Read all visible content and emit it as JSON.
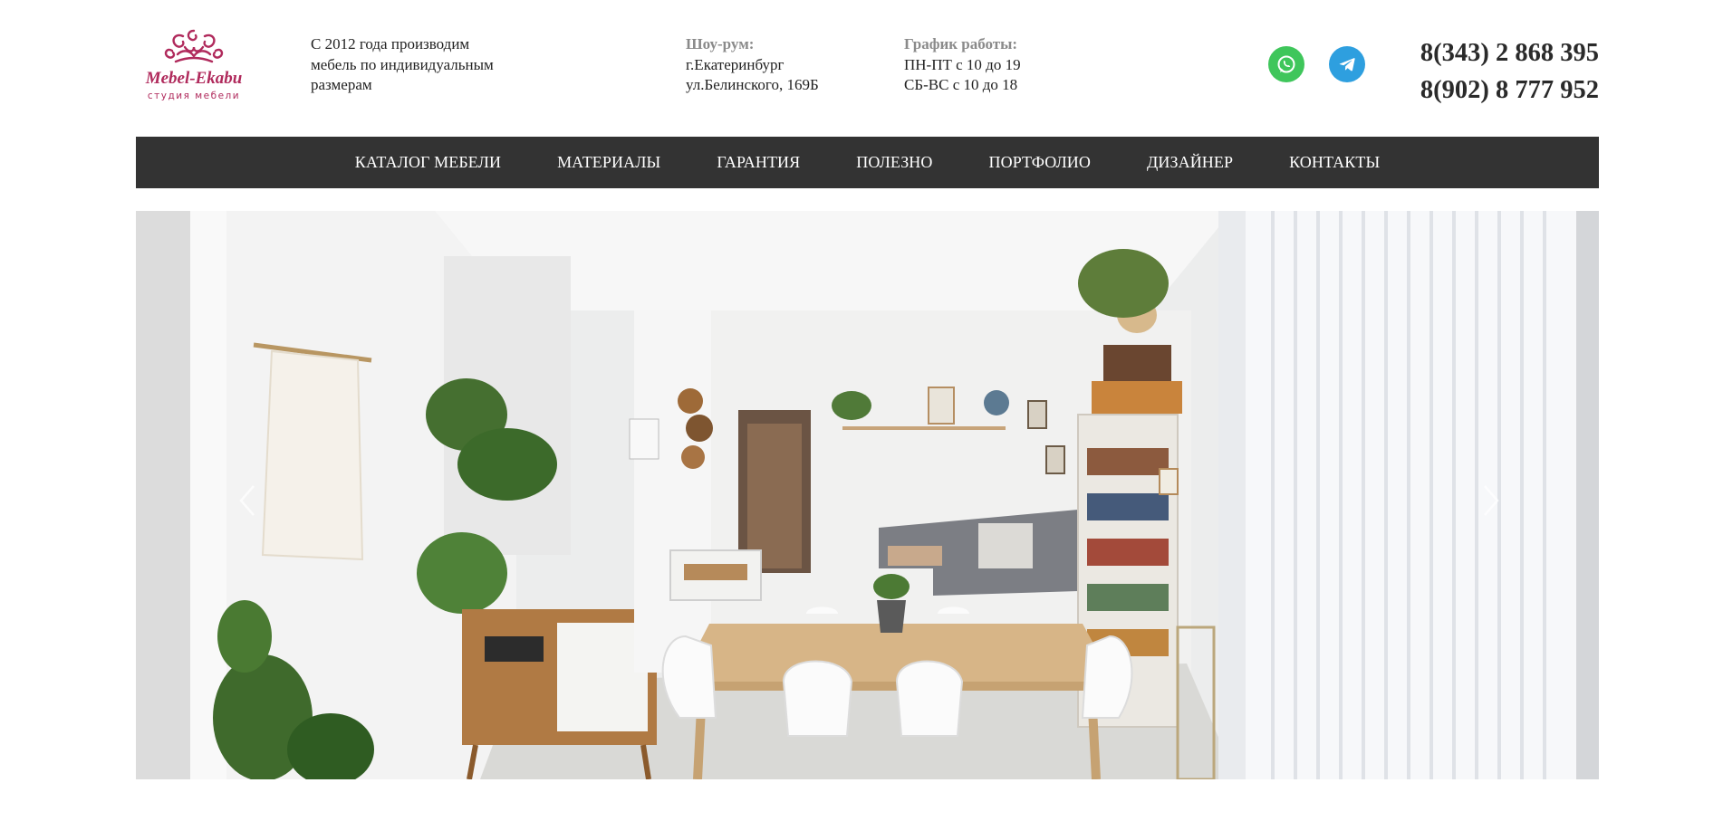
{
  "header": {
    "logo": {
      "brand": "Mebel-Ekabu",
      "subtitle": "студия мебели"
    },
    "tagline": [
      "С 2012 года производим",
      "мебель по индивидуальным",
      "размерам"
    ],
    "showroom": {
      "label": "Шоу-рум:",
      "lines": [
        "г.Екатеринбург",
        "ул.Белинского, 169Б"
      ]
    },
    "schedule": {
      "label": "График работы:",
      "lines": [
        "ПН-ПТ с 10 до 19",
        "СБ-ВС с 10 до 18"
      ]
    },
    "social": {
      "whatsapp_icon": "whatsapp-icon",
      "telegram_icon": "telegram-icon",
      "whatsapp_color": "#3fc65b",
      "telegram_color": "#2e9fdf"
    },
    "phones": [
      "8(343) 2 868 395",
      "8(902) 8 777 952"
    ]
  },
  "nav": {
    "background": "#333333",
    "items": [
      "КАТАЛОГ МЕБЕЛИ",
      "МАТЕРИАЛЫ",
      "ГАРАНТИЯ",
      "ПОЛЕЗНО",
      "ПОРТФОЛИО",
      "ДИЗАЙНЕР",
      "КОНТАКТЫ"
    ]
  },
  "slider": {
    "prev_icon": "chevron-left-icon",
    "next_icon": "chevron-right-icon"
  }
}
